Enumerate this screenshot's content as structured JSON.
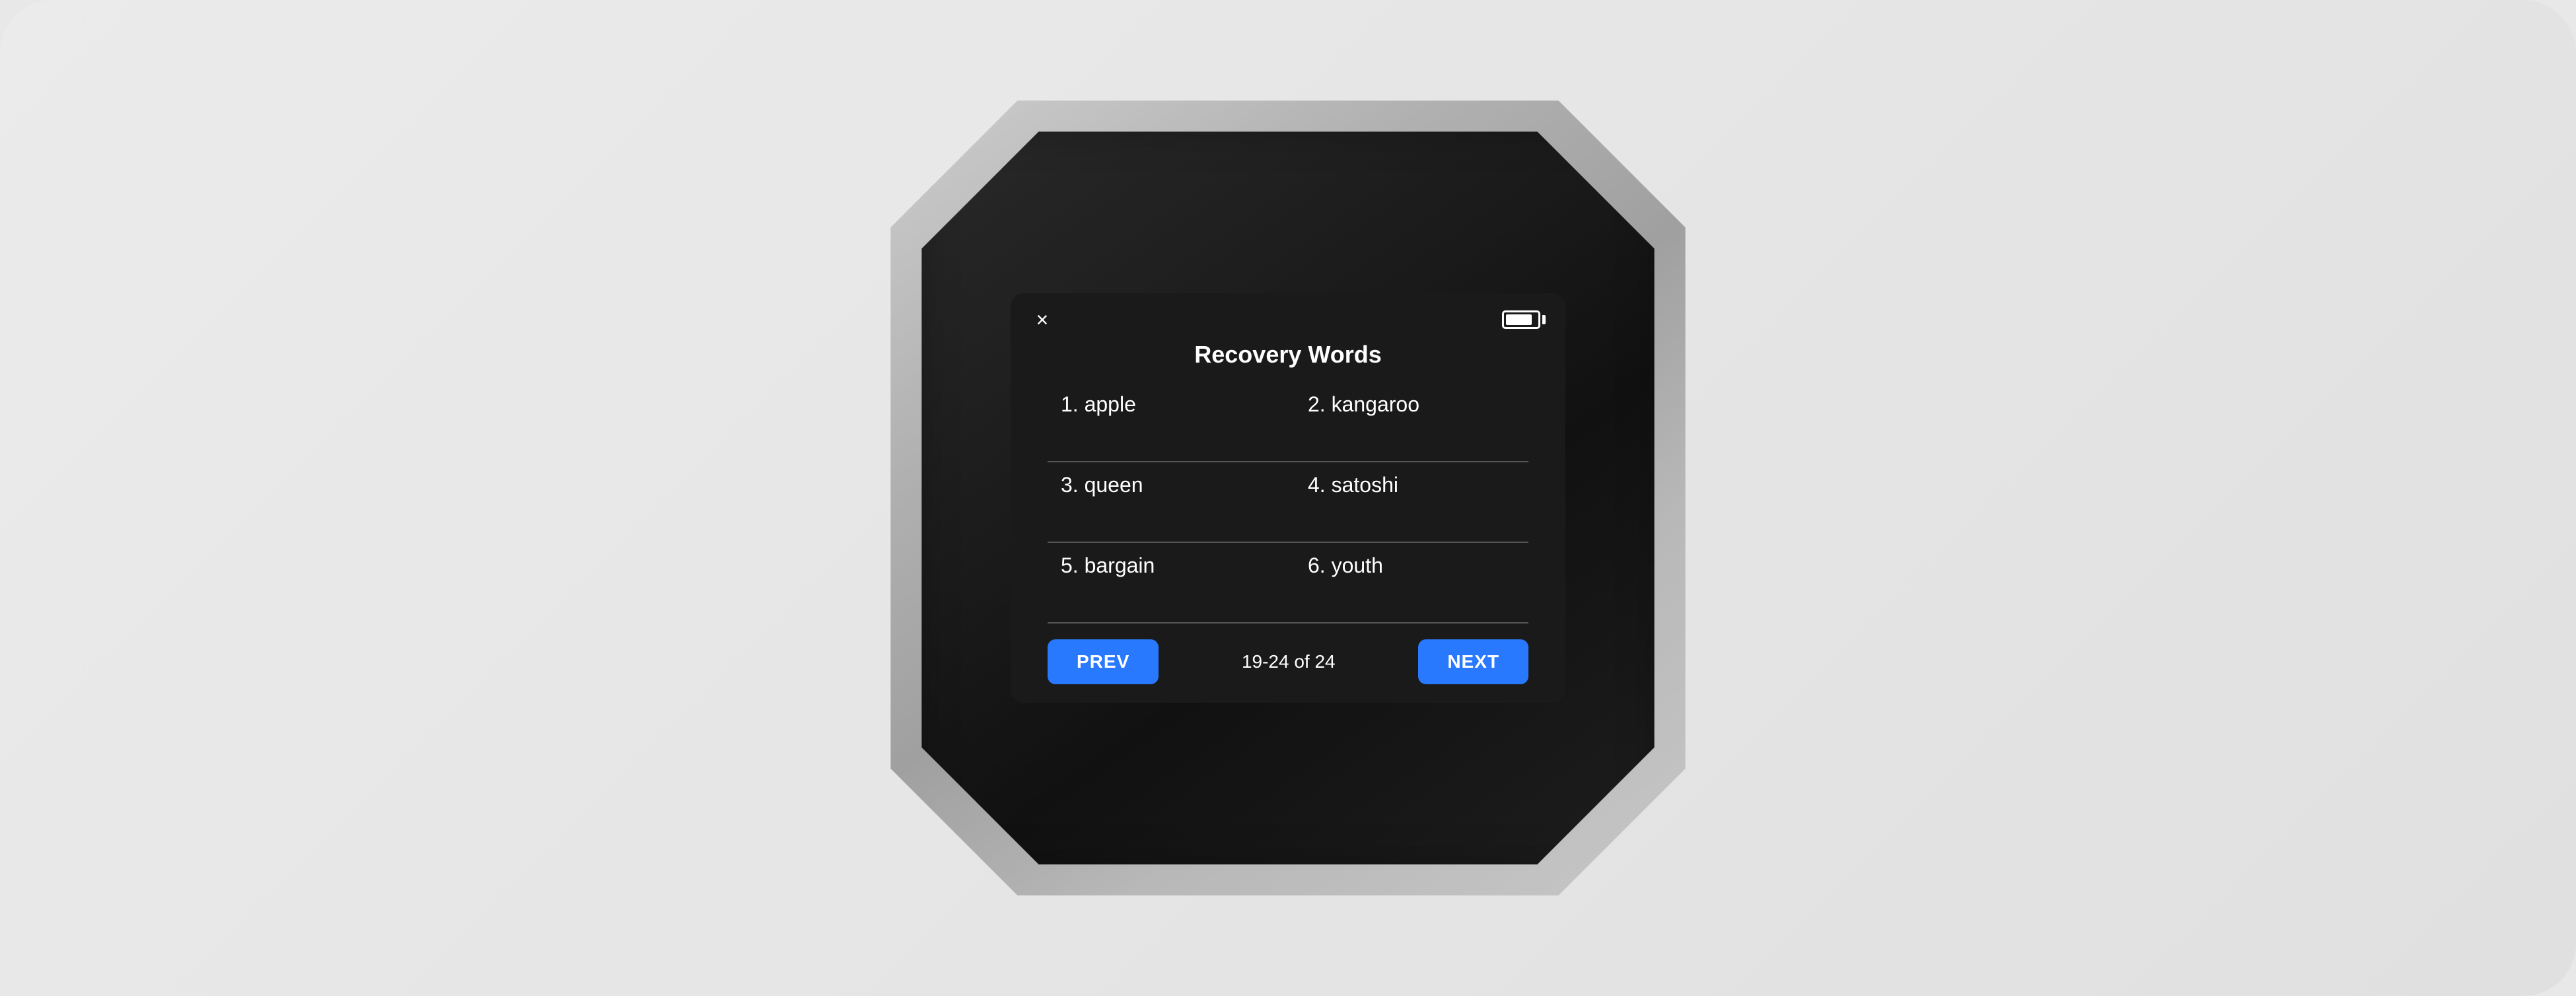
{
  "device": {
    "screen": {
      "title": "Recovery Words",
      "close_icon": "×",
      "battery_level": 85
    },
    "words": [
      {
        "number": "1",
        "word": "apple"
      },
      {
        "number": "2",
        "word": "kangaroo"
      },
      {
        "number": "3",
        "word": "queen"
      },
      {
        "number": "4",
        "word": "satoshi"
      },
      {
        "number": "5",
        "word": "bargain"
      },
      {
        "number": "6",
        "word": "youth"
      }
    ],
    "navigation": {
      "prev_label": "PREV",
      "next_label": "NEXT",
      "page_indicator": "19-24 of 24"
    }
  }
}
